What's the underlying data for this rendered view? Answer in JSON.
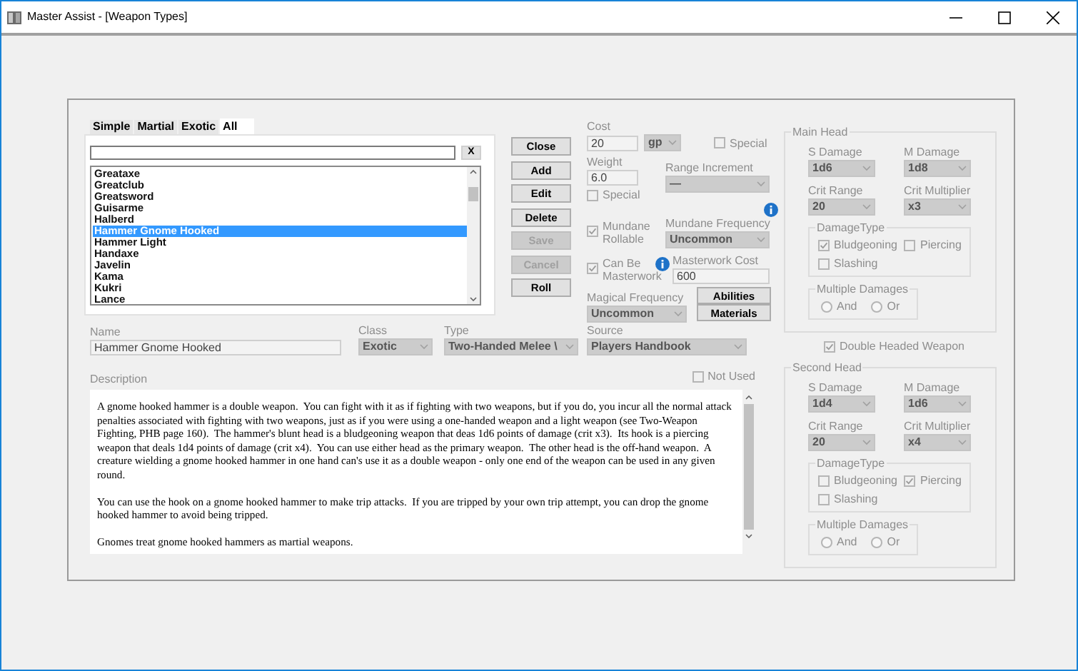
{
  "window": {
    "title": "Master Assist - [Weapon Types]"
  },
  "tabs": [
    {
      "label": "Simple",
      "selected": false
    },
    {
      "label": "Martial",
      "selected": false
    },
    {
      "label": "Exotic",
      "selected": false
    },
    {
      "label": "All",
      "selected": true
    }
  ],
  "clear_button": "X",
  "list": {
    "items": [
      {
        "label": "Greataxe",
        "selected": false
      },
      {
        "label": "Greatclub",
        "selected": false
      },
      {
        "label": "Greatsword",
        "selected": false
      },
      {
        "label": "Guisarme",
        "selected": false
      },
      {
        "label": "Halberd",
        "selected": false
      },
      {
        "label": "Hammer Gnome Hooked",
        "selected": true
      },
      {
        "label": "Hammer Light",
        "selected": false
      },
      {
        "label": "Handaxe",
        "selected": false
      },
      {
        "label": "Javelin",
        "selected": false
      },
      {
        "label": "Kama",
        "selected": false
      },
      {
        "label": "Kukri",
        "selected": false
      },
      {
        "label": "Lance",
        "selected": false
      }
    ]
  },
  "buttons": [
    {
      "label": "Close",
      "disabled": false
    },
    {
      "label": "Add",
      "disabled": false
    },
    {
      "label": "Edit",
      "disabled": false
    },
    {
      "label": "Delete",
      "disabled": false
    },
    {
      "label": "Save",
      "disabled": true
    },
    {
      "label": "Cancel",
      "disabled": true
    },
    {
      "label": "Roll",
      "disabled": false
    }
  ],
  "cost": {
    "label": "Cost",
    "value": "20",
    "unit": "gp",
    "special": {
      "label": "Special",
      "checked": false
    }
  },
  "weight": {
    "label": "Weight",
    "value": "6.0",
    "special": {
      "label": "Special",
      "checked": false
    }
  },
  "range_increment": {
    "label": "Range Increment",
    "value": "—"
  },
  "mundane_rollable": {
    "label": "Mundane Rollable",
    "checked": true
  },
  "mundane_frequency": {
    "label": "Mundane Frequency",
    "value": "Uncommon"
  },
  "can_be_masterwork": {
    "label": "Can Be Masterwork",
    "checked": true
  },
  "masterwork_cost": {
    "label": "Masterwork Cost",
    "value": "600"
  },
  "magical_frequency": {
    "label": "Magical Frequency",
    "value": "Uncommon"
  },
  "side_buttons": [
    "Abilities",
    "Materials"
  ],
  "name": {
    "label": "Name",
    "value": "Hammer Gnome Hooked"
  },
  "class": {
    "label": "Class",
    "value": "Exotic"
  },
  "type": {
    "label": "Type",
    "value": "Two-Handed Melee \\"
  },
  "source": {
    "label": "Source",
    "value": "Players Handbook"
  },
  "description": {
    "label": "Description",
    "paragraphs": [
      "A gnome hooked hammer is a double weapon.  You can fight with it as if fighting with two weapons, but if you do, you incur all the normal attack penalties associated with fighting with two weapons, just as if you were using a one-handed weapon and a light weapon (see Two-Weapon Fighting, PHB page 160).  The hammer's blunt head is a bludgeoning weapon that deas 1d6 points of damage (crit x3).  Its hook is a piercing weapon that deals 1d4 points of damage (crit x4).  You can use either head as the primary weapon.  The other head is the off-hand weapon.  A creature wielding a gnome hooked hammer in one hand can's use it as a double weapon - only one end of the weapon can be used in any given round.",
      "You can use the hook on a gnome hooked hammer to make trip attacks.  If you are tripped by your own trip attempt, you can drop the gnome hooked hammer to avoid being tripped.",
      "Gnomes treat gnome hooked hammers as martial weapons."
    ]
  },
  "not_used": {
    "label": "Not Used",
    "checked": false
  },
  "main_head": {
    "title": "Main Head",
    "fields": [
      {
        "label": "S Damage",
        "value": "1d6"
      },
      {
        "label": "M Damage",
        "value": "1d8"
      },
      {
        "label": "Crit Range",
        "value": "20"
      },
      {
        "label": "Crit Multiplier",
        "value": "x3"
      }
    ],
    "damage_type": {
      "title": "DamageType",
      "options": [
        {
          "label": "Bludgeoning",
          "checked": true
        },
        {
          "label": "Piercing",
          "checked": false
        },
        {
          "label": "Slashing",
          "checked": false
        }
      ]
    },
    "multiple_damages": {
      "title": "Multiple Damages",
      "options": [
        {
          "label": "And",
          "selected": false
        },
        {
          "label": "Or",
          "selected": false
        }
      ]
    }
  },
  "double_headed": {
    "label": "Double Headed Weapon",
    "checked": true
  },
  "second_head": {
    "title": "Second Head",
    "fields": [
      {
        "label": "S Damage",
        "value": "1d4"
      },
      {
        "label": "M Damage",
        "value": "1d6"
      },
      {
        "label": "Crit Range",
        "value": "20"
      },
      {
        "label": "Crit Multiplier",
        "value": "x4"
      }
    ],
    "damage_type": {
      "title": "DamageType",
      "options": [
        {
          "label": "Bludgeoning",
          "checked": false
        },
        {
          "label": "Piercing",
          "checked": true
        },
        {
          "label": "Slashing",
          "checked": false
        }
      ]
    },
    "multiple_damages": {
      "title": "Multiple Damages",
      "options": [
        {
          "label": "And",
          "selected": false
        },
        {
          "label": "Or",
          "selected": false
        }
      ]
    }
  }
}
